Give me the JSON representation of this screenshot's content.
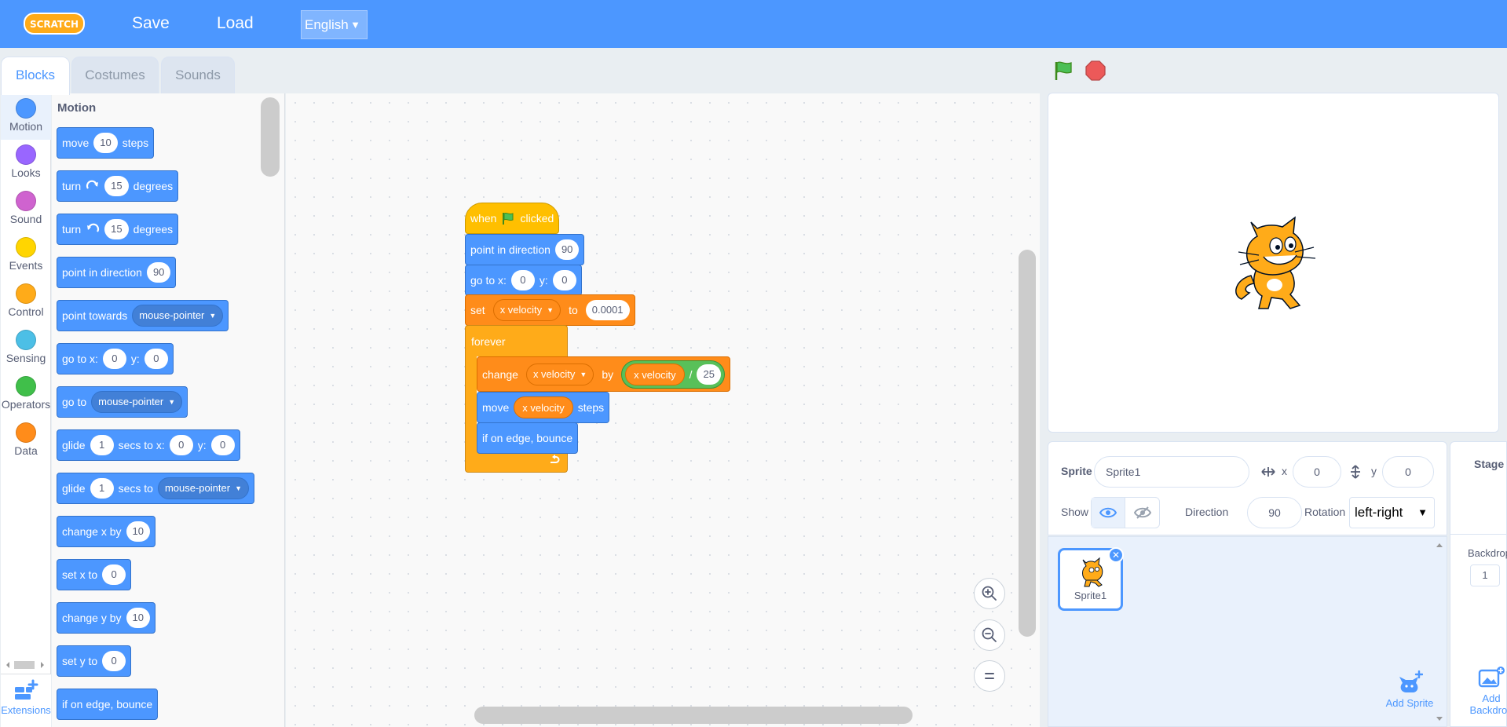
{
  "menubar": {
    "logo_text": "SCRATCH",
    "save": "Save",
    "load": "Load",
    "language": "English"
  },
  "tabs": [
    {
      "label": "Blocks"
    },
    {
      "label": "Costumes"
    },
    {
      "label": "Sounds"
    }
  ],
  "categories": [
    {
      "label": "Motion",
      "color": "#4c97ff"
    },
    {
      "label": "Looks",
      "color": "#9966ff"
    },
    {
      "label": "Sound",
      "color": "#cf63cf"
    },
    {
      "label": "Events",
      "color": "#ffd500"
    },
    {
      "label": "Control",
      "color": "#ffab19"
    },
    {
      "label": "Sensing",
      "color": "#4cbfe6"
    },
    {
      "label": "Operators",
      "color": "#40bf4a"
    },
    {
      "label": "Data",
      "color": "#ff8c1a"
    }
  ],
  "extensions_label": "Extensions",
  "palette": {
    "title": "Motion",
    "move": {
      "a": "move",
      "v": "10",
      "b": "steps"
    },
    "turn_right": {
      "a": "turn",
      "v": "15",
      "b": "degrees"
    },
    "turn_left": {
      "a": "turn",
      "v": "15",
      "b": "degrees"
    },
    "point_dir": {
      "a": "point in direction",
      "v": "90"
    },
    "point_towards": {
      "a": "point towards",
      "d": "mouse-pointer"
    },
    "goto_xy": {
      "a": "go to x:",
      "x": "0",
      "b": "y:",
      "y": "0"
    },
    "goto": {
      "a": "go to",
      "d": "mouse-pointer"
    },
    "glide_xy": {
      "a": "glide",
      "s": "1",
      "b": "secs to x:",
      "x": "0",
      "c": "y:",
      "y": "0"
    },
    "glide_to": {
      "a": "glide",
      "s": "1",
      "b": "secs to",
      "d": "mouse-pointer"
    },
    "change_x": {
      "a": "change x by",
      "v": "10"
    },
    "set_x": {
      "a": "set x to",
      "v": "0"
    },
    "change_y": {
      "a": "change y by",
      "v": "10"
    },
    "set_y": {
      "a": "set y to",
      "v": "0"
    },
    "bounce": {
      "a": "if on edge, bounce"
    }
  },
  "script": {
    "hat": {
      "a": "when",
      "b": "clicked"
    },
    "point_dir": {
      "a": "point in direction",
      "v": "90"
    },
    "goto_xy": {
      "a": "go to x:",
      "x": "0",
      "b": "y:",
      "y": "0"
    },
    "set_var": {
      "a": "set",
      "var": "x velocity",
      "b": "to",
      "v": "0.0001"
    },
    "forever": "forever",
    "change_var": {
      "a": "change",
      "var": "x velocity",
      "b": "by",
      "rep": "x velocity",
      "op": "/",
      "v": "25"
    },
    "move": {
      "a": "move",
      "rep": "x velocity",
      "b": "steps"
    },
    "bounce": "if on edge, bounce"
  },
  "sprite_info": {
    "sprite_label": "Sprite",
    "sprite_name": "Sprite1",
    "x_label": "x",
    "x": "0",
    "y_label": "y",
    "y": "0",
    "show_label": "Show",
    "direction_label": "Direction",
    "direction": "90",
    "rotation_label": "Rotation",
    "rotation": "left-right"
  },
  "sprites": [
    {
      "name": "Sprite1"
    }
  ],
  "add_sprite": "Add Sprite",
  "stage_panel": {
    "title": "Stage",
    "backdrops_label": "Backdrops",
    "backdrops_count": "1",
    "add_backdrop": "Add Backdrop"
  }
}
